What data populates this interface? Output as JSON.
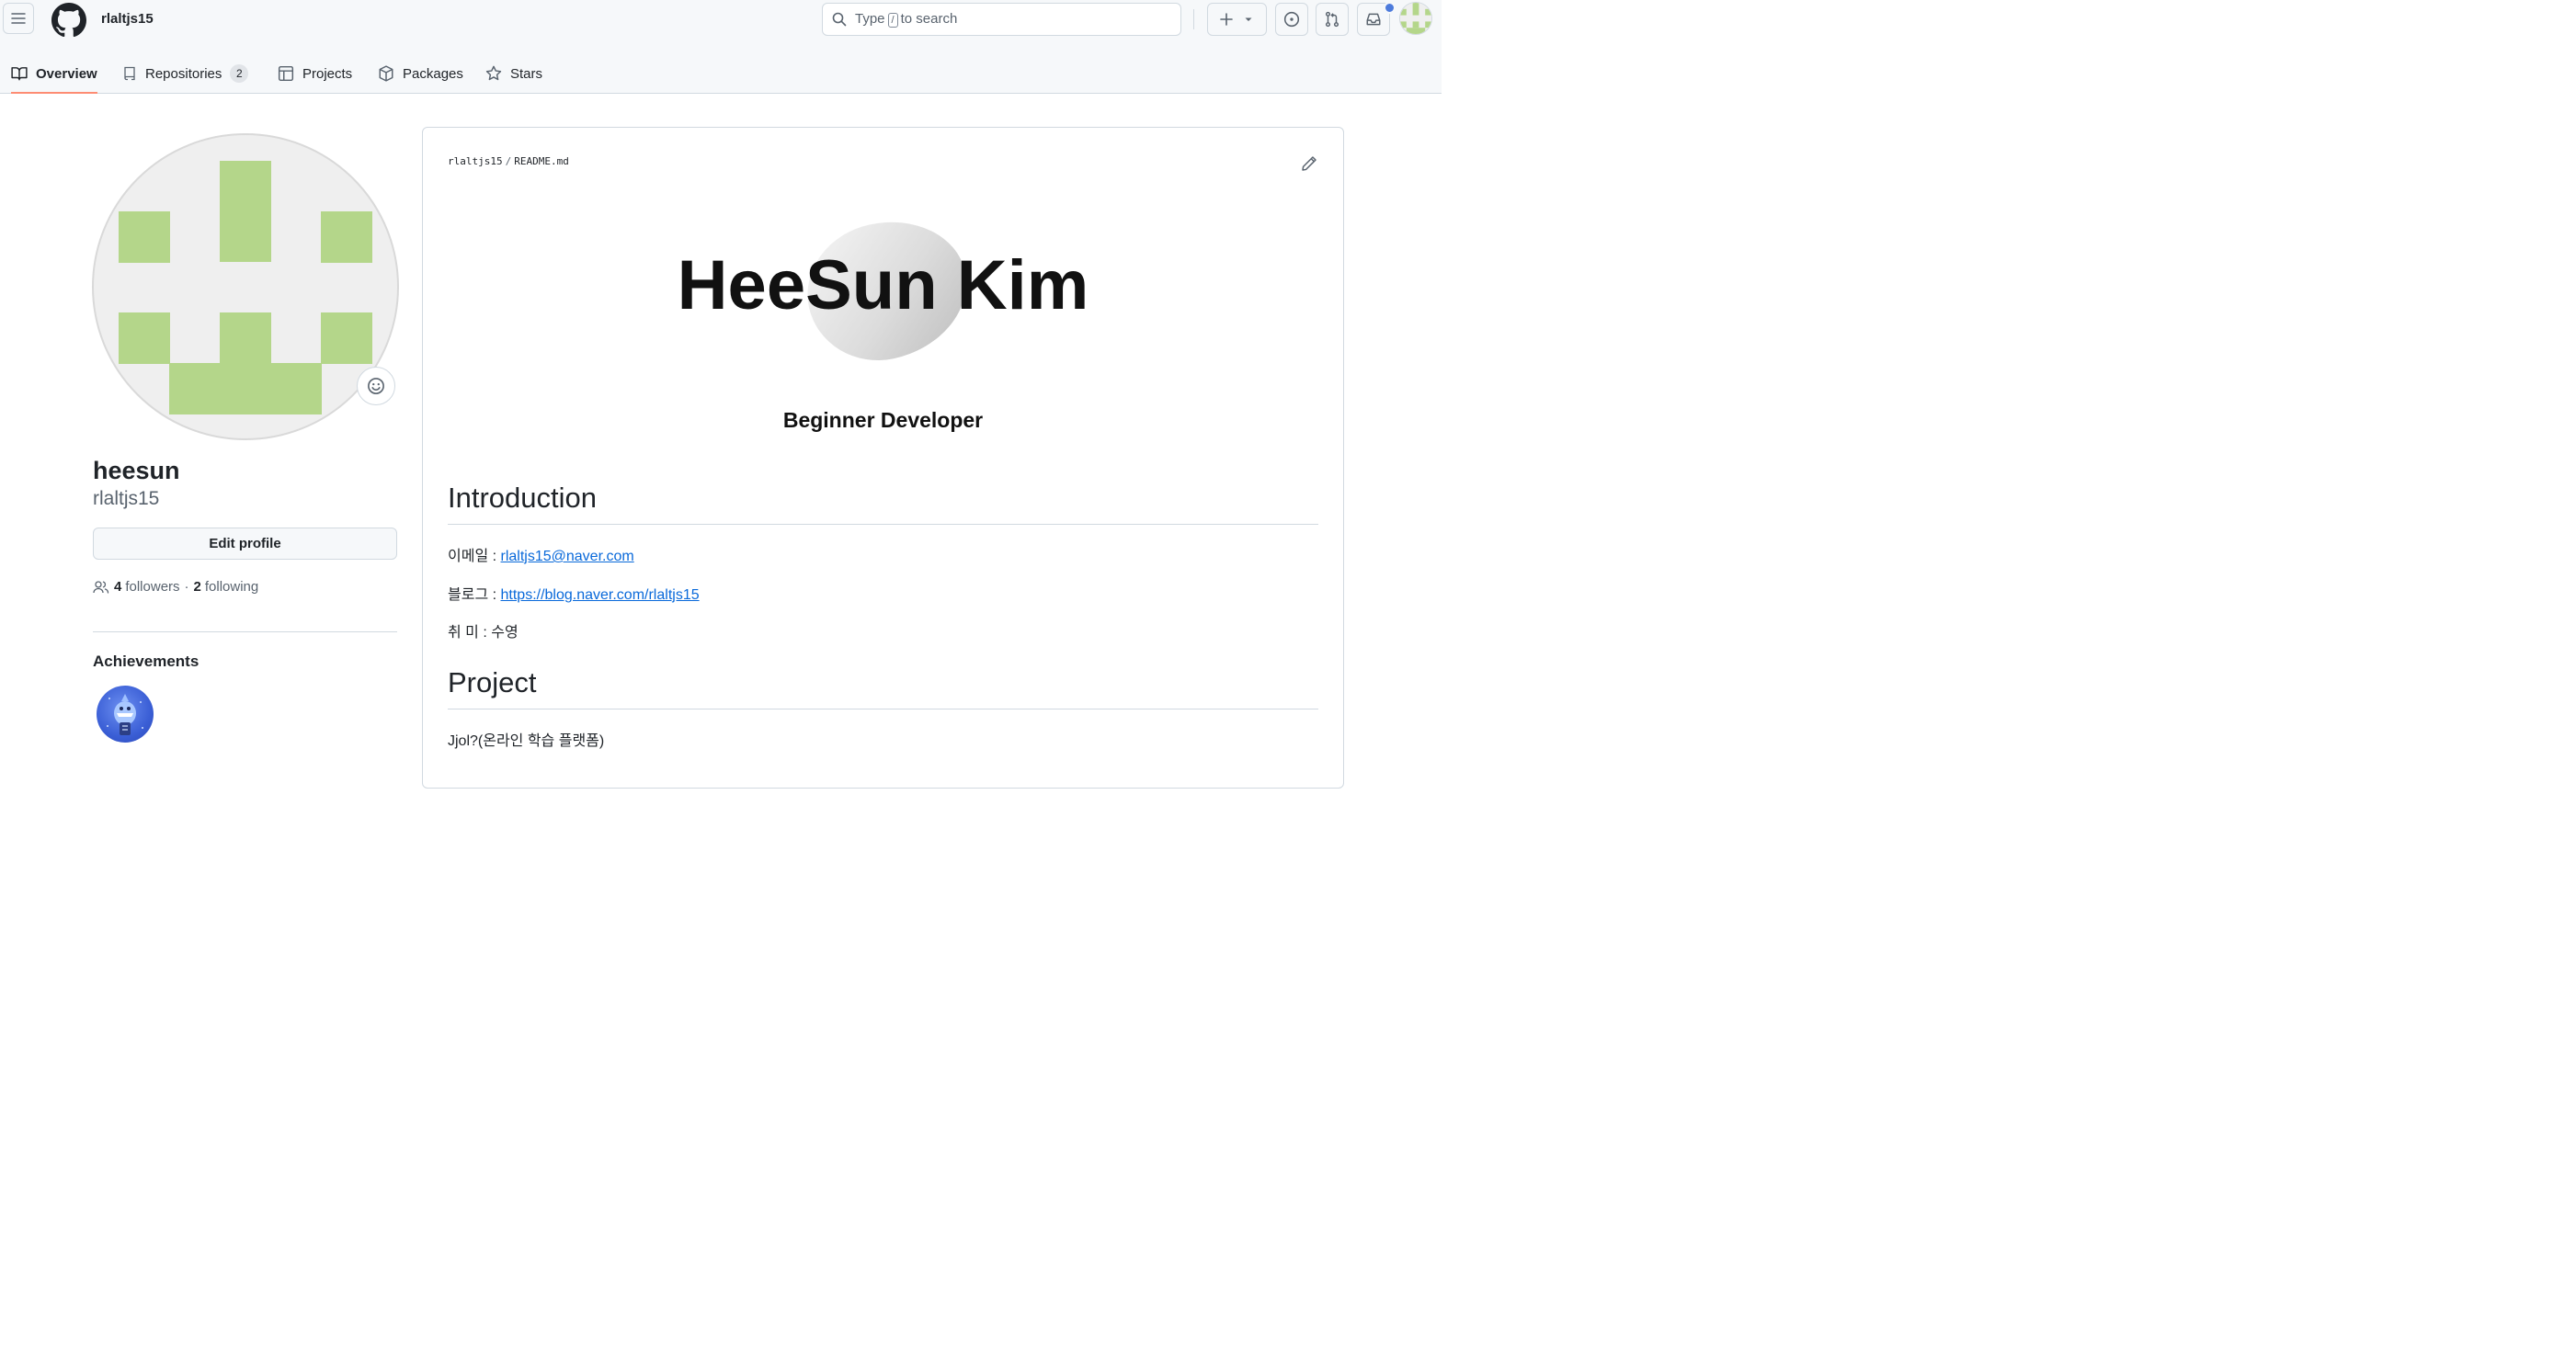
{
  "header": {
    "context": "rlaltjs15",
    "search": {
      "prefix": "Type",
      "key": "/",
      "suffix": "to search"
    }
  },
  "tabs": [
    {
      "label": "Overview",
      "icon": "book-icon",
      "active": true
    },
    {
      "label": "Repositories",
      "icon": "repo-icon",
      "count": "2"
    },
    {
      "label": "Projects",
      "icon": "table-icon"
    },
    {
      "label": "Packages",
      "icon": "package-icon"
    },
    {
      "label": "Stars",
      "icon": "star-icon"
    }
  ],
  "profile": {
    "name": "heesun",
    "login": "rlaltjs15",
    "edit_label": "Edit profile",
    "followers_count": "4",
    "followers_label": "followers",
    "sep": "·",
    "following_count": "2",
    "following_label": "following",
    "achievements_title": "Achievements"
  },
  "readme": {
    "owner": "rlaltjs15",
    "file": "README.md",
    "hero": "HeeSun Kim",
    "subtitle": "Beginner Developer",
    "intro_heading": "Introduction",
    "email_label": "이메일 : ",
    "email": "rlaltjs15@naver.com",
    "blog_label": "블로그 : ",
    "blog": "https://blog.naver.com/rlaltjs15",
    "hobby": "취 미 : 수영",
    "project_heading": "Project",
    "project_item": "Jjol?(온라인 학습 플랫폼)"
  },
  "colors": {
    "identicon": "#b4d68a",
    "tab_underline": "#fd8c73",
    "link": "#0969da",
    "notification": "#4d7bdc"
  }
}
